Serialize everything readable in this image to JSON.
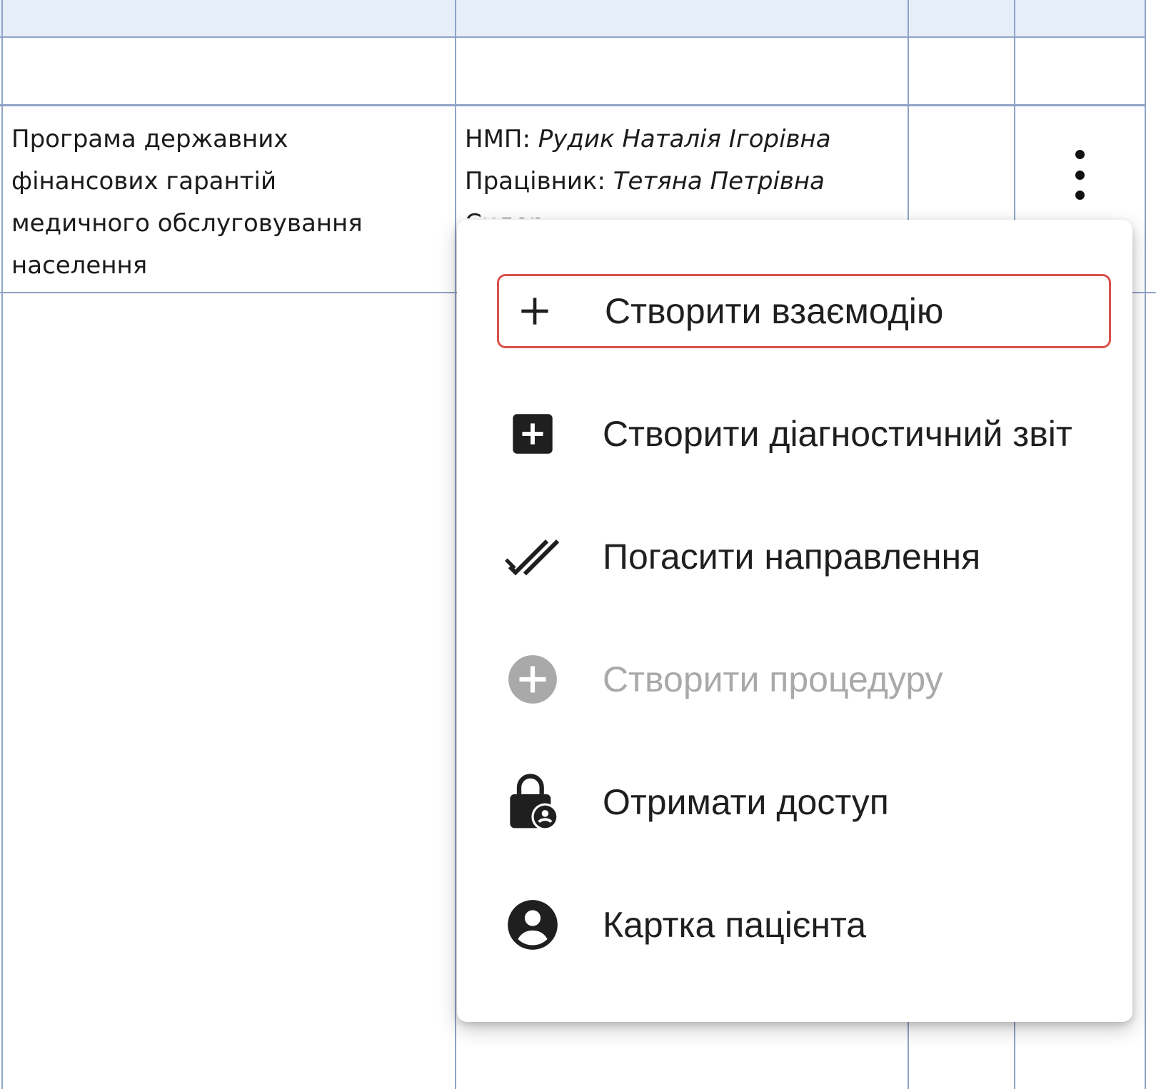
{
  "table": {
    "row": {
      "program_lines": [
        "Програма державних",
        "фінансових гарантій",
        "медичного обслуговування",
        "населення"
      ],
      "nmp_label": "НМП:",
      "nmp_name": "Рудик Наталія Ігорівна",
      "worker_label": "Працівник:",
      "worker_name": "Тетяна Петрівна",
      "worker_name_overflow": "Сидор..."
    }
  },
  "menu": {
    "items": [
      {
        "label": "Створити взаємодію",
        "icon": "plus-icon",
        "state": "highlighted"
      },
      {
        "label": "Створити діагностичний звіт",
        "icon": "add-box-icon",
        "state": "enabled"
      },
      {
        "label": "Погасити направлення",
        "icon": "done-all-icon",
        "state": "enabled"
      },
      {
        "label": "Створити процедуру",
        "icon": "add-circle-icon",
        "state": "disabled"
      },
      {
        "label": "Отримати доступ",
        "icon": "lock-person-icon",
        "state": "enabled"
      },
      {
        "label": "Картка пацієнта",
        "icon": "account-circle-icon",
        "state": "enabled"
      }
    ]
  },
  "colors": {
    "grid": "#8fa3c7",
    "header": "#e6eef9",
    "highlight_border": "#d9524a",
    "disabled_text": "#a9a9a9"
  }
}
